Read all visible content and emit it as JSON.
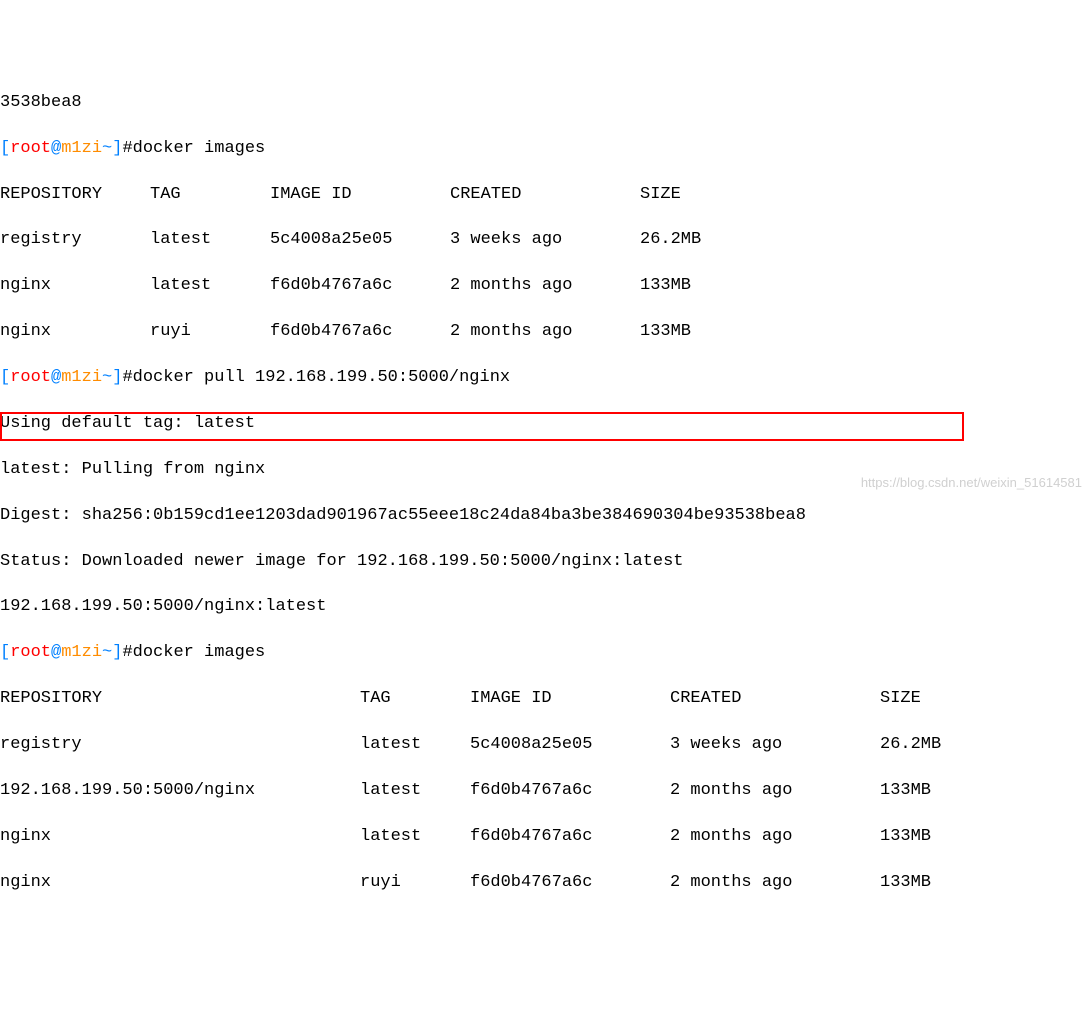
{
  "lines": {
    "l0": "3538bea8",
    "prompt_user": "root",
    "prompt_host": "m1zi",
    "prompt_path": "~",
    "cmd1": "docker images",
    "cmd2": "docker pull 192.168.199.50:5000/nginx",
    "cmd3": "docker images"
  },
  "table1": {
    "headers": {
      "repo": "REPOSITORY",
      "tag": "TAG",
      "id": "IMAGE ID",
      "created": "CREATED",
      "size": "SIZE"
    },
    "rows": [
      {
        "repo": "registry",
        "tag": "latest",
        "id": "5c4008a25e05",
        "created": "3 weeks ago",
        "size": "26.2MB"
      },
      {
        "repo": "nginx",
        "tag": "latest",
        "id": "f6d0b4767a6c",
        "created": "2 months ago",
        "size": "133MB"
      },
      {
        "repo": "nginx",
        "tag": "ruyi",
        "id": "f6d0b4767a6c",
        "created": "2 months ago",
        "size": "133MB"
      }
    ]
  },
  "pull_output": {
    "l1": "Using default tag: latest",
    "l2": "latest: Pulling from nginx",
    "l3": "Digest: sha256:0b159cd1ee1203dad901967ac55eee18c24da84ba3be384690304be93538bea8",
    "l4": "Status: Downloaded newer image for 192.168.199.50:5000/nginx:latest",
    "l5": "192.168.199.50:5000/nginx:latest"
  },
  "table2": {
    "headers": {
      "repo": "REPOSITORY",
      "tag": "TAG",
      "id": "IMAGE ID",
      "created": "CREATED",
      "size": "SIZE"
    },
    "rows": [
      {
        "repo": "registry",
        "tag": "latest",
        "id": "5c4008a25e05",
        "created": "3 weeks ago",
        "size": "26.2MB"
      },
      {
        "repo": "192.168.199.50:5000/nginx",
        "tag": "latest",
        "id": "f6d0b4767a6c",
        "created": "2 months ago",
        "size": "133MB"
      },
      {
        "repo": "nginx",
        "tag": "latest",
        "id": "f6d0b4767a6c",
        "created": "2 months ago",
        "size": "133MB"
      },
      {
        "repo": "nginx",
        "tag": "ruyi",
        "id": "f6d0b4767a6c",
        "created": "2 months ago",
        "size": "133MB"
      }
    ]
  },
  "watermark": "https://blog.csdn.net/weixin_51614581"
}
